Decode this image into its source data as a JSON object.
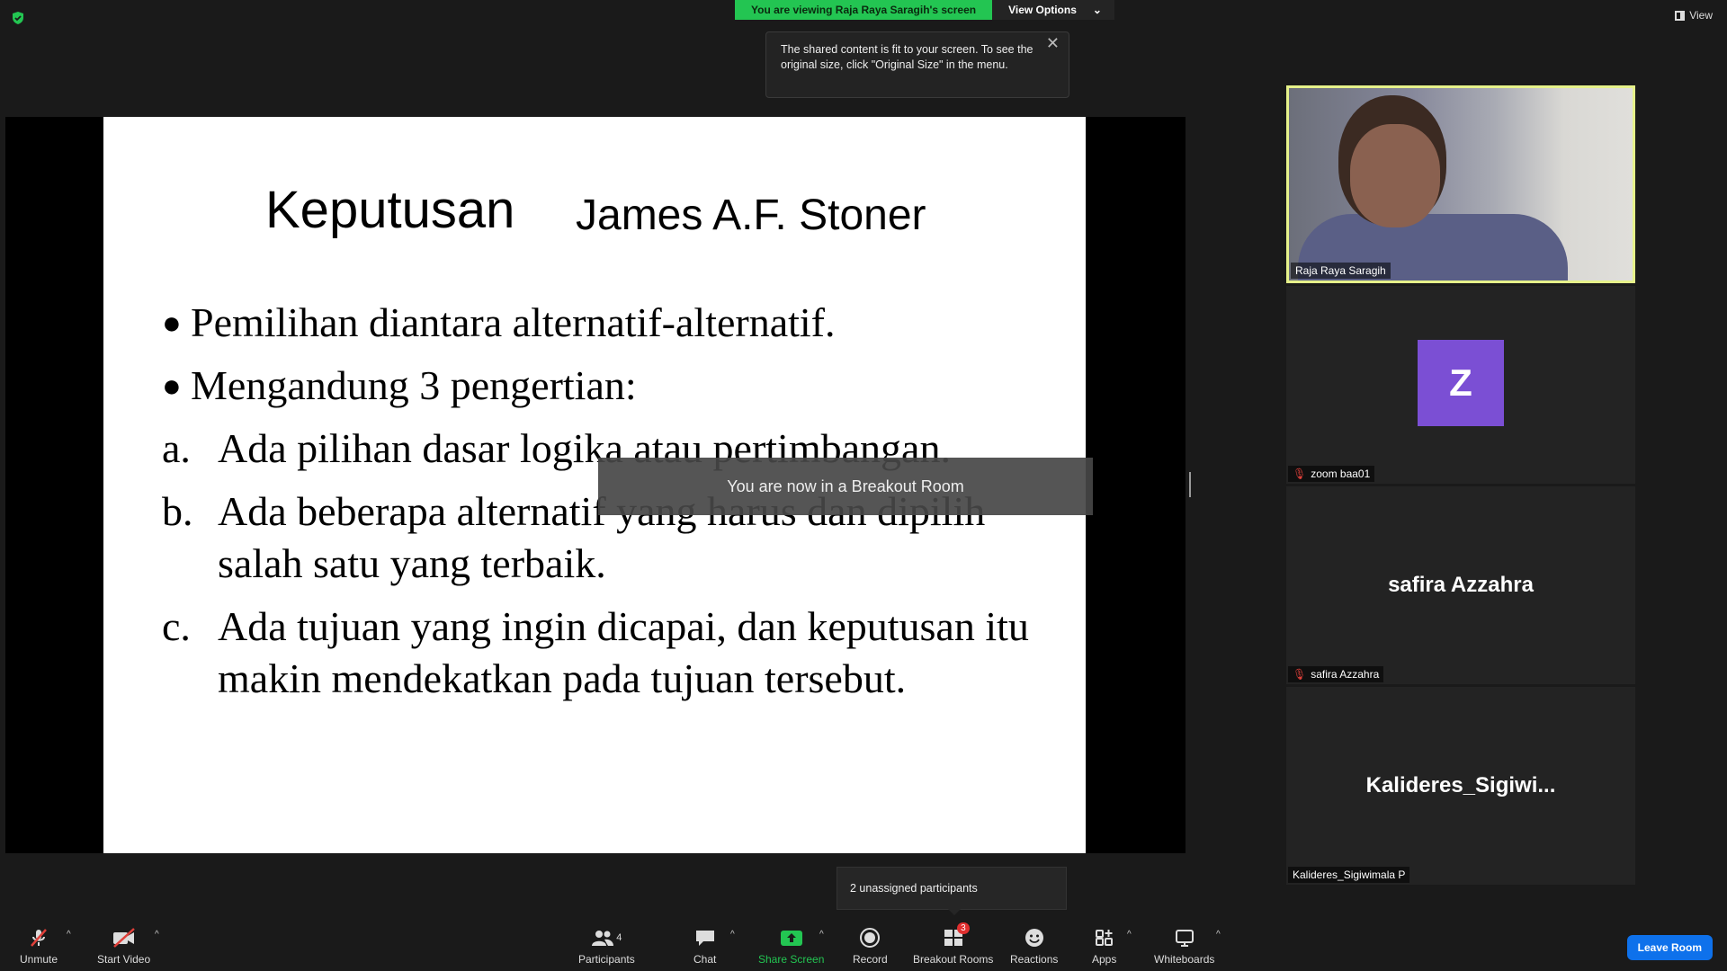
{
  "banner": {
    "viewing_text": "You are viewing Raja Raya Saragih's screen",
    "view_options_label": "View Options"
  },
  "top_right": {
    "view_label": "View"
  },
  "tooltip": {
    "text": "The shared content is fit to your screen. To see the original size, click \"Original Size\" in the menu."
  },
  "slide": {
    "title": "Keputusan",
    "author": "James A.F. Stoner",
    "bullets": [
      "Pemilihan diantara alternatif-alternatif.",
      "Mengandung 3 pengertian:"
    ],
    "items": [
      {
        "mark": "a.",
        "text": "Ada pilihan dasar logika atau pertimbangan."
      },
      {
        "mark": "b.",
        "text": "Ada beberapa alternatif yang harus dan dipilih salah satu yang terbaik."
      },
      {
        "mark": "c.",
        "text": "Ada tujuan yang ingin dicapai, dan keputusan itu makin mendekatkan pada tujuan tersebut."
      }
    ]
  },
  "breakout_message": "You are now in a Breakout Room",
  "participants_tiles": [
    {
      "name": "Raja Raya Saragih",
      "muted": false
    },
    {
      "name": "zoom baa01",
      "avatar_letter": "Z",
      "muted": true
    },
    {
      "name": "safira Azzahra",
      "display_name": "safira Azzahra",
      "muted": true
    },
    {
      "name": "Kalideres_Sigiwimala P",
      "display_name": "Kalideres_Sigiwi...",
      "muted": false
    }
  ],
  "unassigned": "2 unassigned participants",
  "toolbar": {
    "unmute": "Unmute",
    "start_video": "Start Video",
    "participants": "Participants",
    "participants_count": "4",
    "chat": "Chat",
    "share_screen": "Share Screen",
    "record": "Record",
    "breakout_rooms": "Breakout Rooms",
    "breakout_badge": "3",
    "reactions": "Reactions",
    "apps": "Apps",
    "whiteboards": "Whiteboards",
    "leave_room": "Leave Room"
  },
  "colors": {
    "banner_green": "#23c552",
    "active_border": "#e6f28a",
    "avatar_purple": "#7b4fd4",
    "leave_blue": "#0e71eb"
  }
}
